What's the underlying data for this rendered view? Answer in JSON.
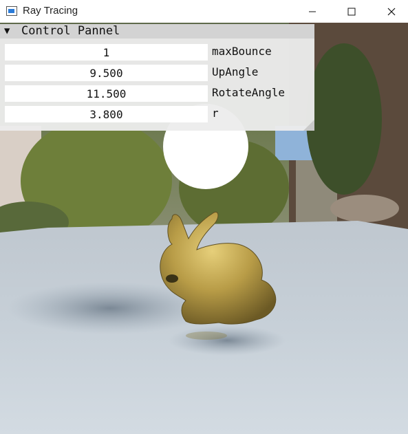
{
  "window": {
    "title": "Ray Tracing",
    "controls": {
      "minimize": "minimize-icon",
      "maximize": "maximize-icon",
      "close": "close-icon"
    }
  },
  "panel": {
    "title": "Control Pannel",
    "collapse_icon": "triangle-down-icon",
    "fields": [
      {
        "value": "1",
        "label": "maxBounce"
      },
      {
        "value": "9.500",
        "label": "UpAngle"
      },
      {
        "value": "11.500",
        "label": "RotateAngle"
      },
      {
        "value": "3.800",
        "label": "r"
      }
    ]
  },
  "scene": {
    "description_icon": "rendered-scene",
    "colors": {
      "floor": "#c9d2da",
      "bunny": "#b59a45",
      "light": "#ffffff",
      "sky": "#8fb3d9"
    }
  }
}
